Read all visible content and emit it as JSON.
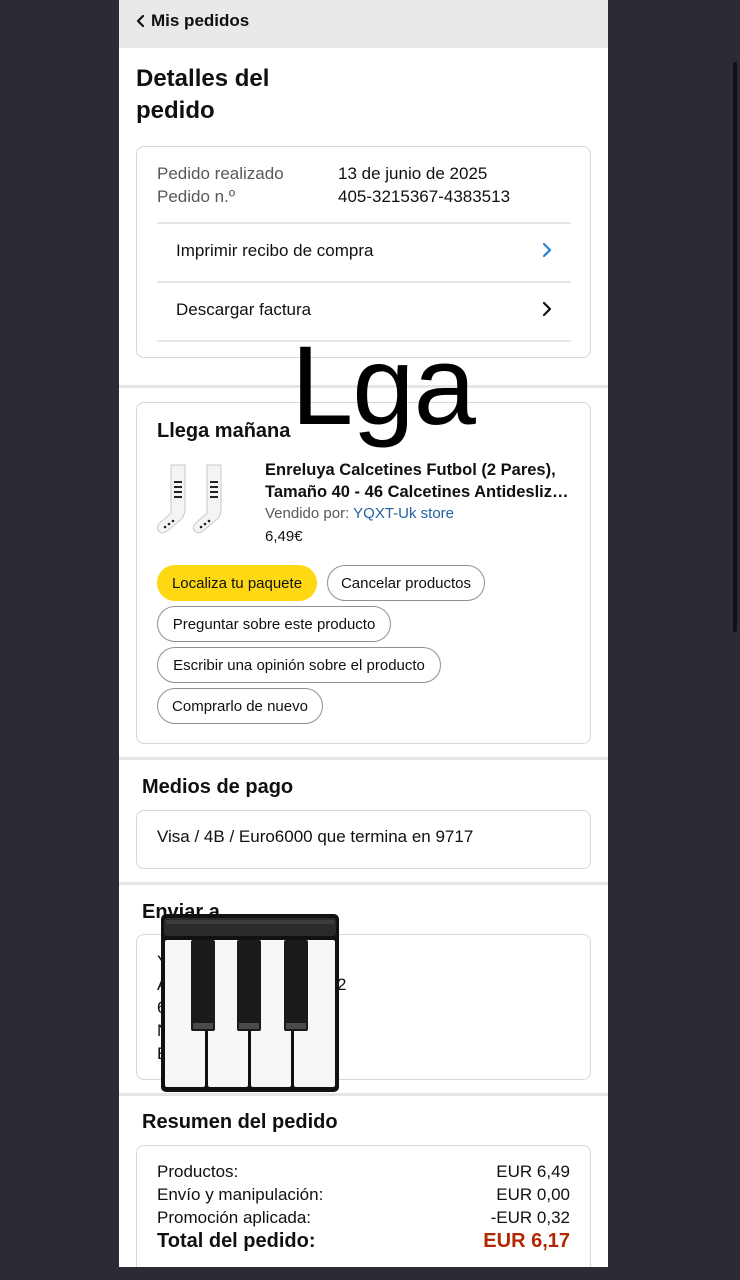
{
  "header": {
    "back_label": "Mis pedidos"
  },
  "page_title": "Detalles del pedido",
  "order_info": {
    "placed_label": "Pedido realizado",
    "placed_value": "13 de junio de 2025",
    "number_label": "Pedido n.º",
    "number_value": "405-3215367-4383513",
    "print_receipt": "Imprimir recibo de compra",
    "download_invoice": "Descargar factura"
  },
  "shipment": {
    "status": "Llega mañana",
    "product_line1": "Enreluya Calcetines Futbol (2 Pares),",
    "product_line2": "Tamaño 40 - 46 Calcetines Antideslizantes",
    "seller_prefix": "Vendido por:",
    "seller_name": "YQXT-Uk store",
    "price": "6,49€",
    "buttons": {
      "track": "Localiza tu paquete",
      "cancel": "Cancelar productos",
      "ask": "Preguntar sobre este producto",
      "review": "Escribir una opinión sobre el producto",
      "buy_again": "Comprarlo de nuevo"
    }
  },
  "payment": {
    "title": "Medios de pago",
    "method": "Visa / 4B / Euro6000  que termina en 9717"
  },
  "shipping": {
    "title": "Enviar a",
    "lines": [
      "Y",
      "A",
      "6",
      "N",
      "E"
    ],
    "line2_tail": "2"
  },
  "summary": {
    "title": "Resumen del pedido",
    "products_label": "Productos:",
    "products_value": "EUR 6,49",
    "shipping_label": "Envío y manipulación:",
    "shipping_value": "EUR 0,00",
    "promo_label": "Promoción aplicada:",
    "promo_value": "-EUR 0,32",
    "total_label": "Total del pedido:",
    "total_value": "EUR 6,17"
  },
  "overlay": {
    "text": "Lga",
    "piano_icon": "piano-keys-icon"
  },
  "colors": {
    "primary_button": "#FFD814",
    "link": "#2162A1",
    "total_price": "#B12704",
    "chevron_blue": "#2F7FD6",
    "background": "#2B2B35"
  }
}
